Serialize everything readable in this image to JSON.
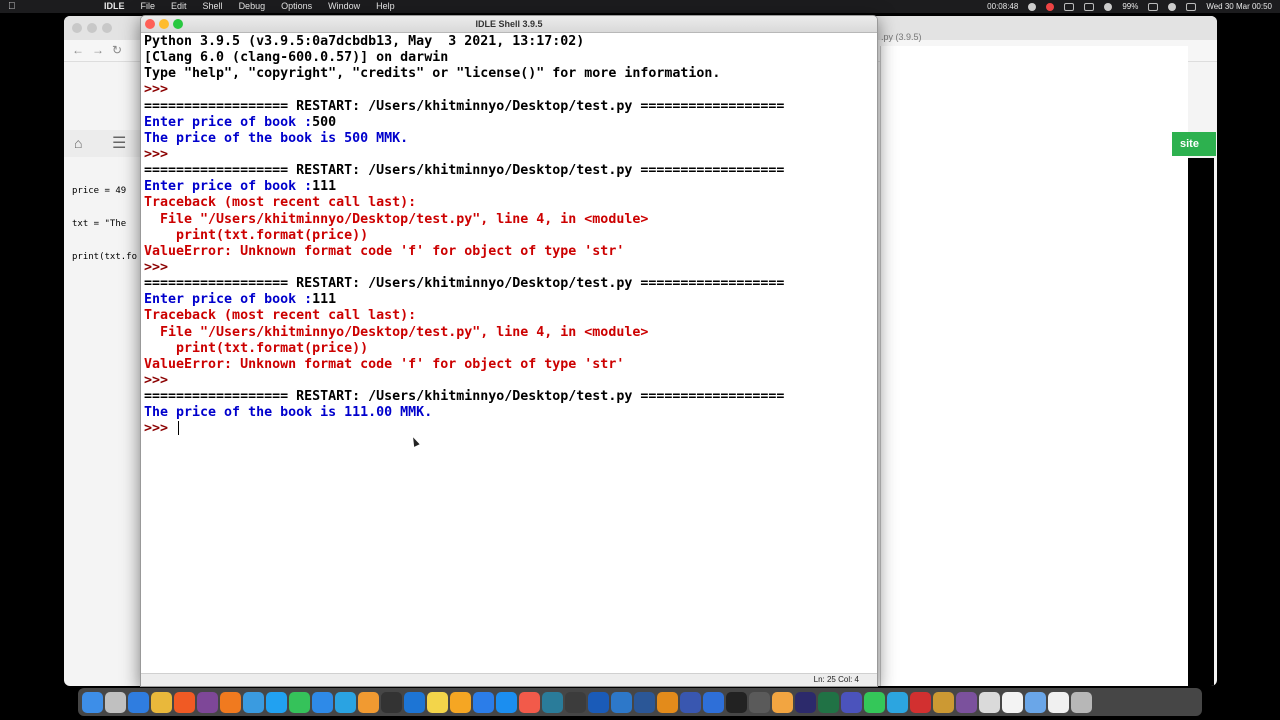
{
  "menubar": {
    "apple_icon": "apple-icon",
    "app_name": "IDLE",
    "menus": [
      "File",
      "Edit",
      "Shell",
      "Debug",
      "Options",
      "Window",
      "Help"
    ],
    "clock": "00:08:48",
    "battery": "99%",
    "datetime": "Wed 30 Mar  00:50"
  },
  "browser": {
    "right_title": ".py (3.9.5)",
    "green_button_label": "site",
    "code_lines": [
      "price = 49",
      "txt = \"The",
      "print(txt.fo"
    ]
  },
  "idle": {
    "title": "IDLE Shell 3.9.5",
    "status": "Ln: 25  Col: 4",
    "lines": [
      {
        "cls": "c-out",
        "text": "Python 3.9.5 (v3.9.5:0a7dcbdb13, May  3 2021, 13:17:02)"
      },
      {
        "cls": "c-out",
        "text": "[Clang 6.0 (clang-600.0.57)] on darwin"
      },
      {
        "cls": "c-out",
        "text": "Type \"help\", \"copyright\", \"credits\" or \"license()\" for more information."
      },
      {
        "cls": "c-prompt",
        "text": ">>>"
      },
      {
        "cls": "c-out",
        "text": "================== RESTART: /Users/khitminnyo/Desktop/test.py =================="
      },
      {
        "cls": "c-stdout",
        "text": "Enter price of book :",
        "input": "500"
      },
      {
        "cls": "c-stdout",
        "text": "The price of the book is 500 MMK."
      },
      {
        "cls": "c-prompt",
        "text": ">>>"
      },
      {
        "cls": "c-out",
        "text": "================== RESTART: /Users/khitminnyo/Desktop/test.py =================="
      },
      {
        "cls": "c-stdout",
        "text": "Enter price of book :",
        "input": "111"
      },
      {
        "cls": "c-err",
        "text": "Traceback (most recent call last):"
      },
      {
        "cls": "c-err",
        "text": "  File \"/Users/khitminnyo/Desktop/test.py\", line 4, in <module>"
      },
      {
        "cls": "c-err",
        "text": "    print(txt.format(price))"
      },
      {
        "cls": "c-err",
        "text": "ValueError: Unknown format code 'f' for object of type 'str'"
      },
      {
        "cls": "c-prompt",
        "text": ">>>"
      },
      {
        "cls": "c-out",
        "text": "================== RESTART: /Users/khitminnyo/Desktop/test.py =================="
      },
      {
        "cls": "c-stdout",
        "text": "Enter price of book :",
        "input": "111"
      },
      {
        "cls": "c-err",
        "text": "Traceback (most recent call last):"
      },
      {
        "cls": "c-err",
        "text": "  File \"/Users/khitminnyo/Desktop/test.py\", line 4, in <module>"
      },
      {
        "cls": "c-err",
        "text": "    print(txt.format(price))"
      },
      {
        "cls": "c-err",
        "text": "ValueError: Unknown format code 'f' for object of type 'str'"
      },
      {
        "cls": "c-prompt",
        "text": ">>>"
      },
      {
        "cls": "c-out",
        "text": "================== RESTART: /Users/khitminnyo/Desktop/test.py =================="
      },
      {
        "cls": "c-stdout",
        "text": "The price of the book is 111.00 MMK."
      },
      {
        "cls": "c-prompt",
        "text": ">>>",
        "cursor": true
      }
    ]
  },
  "dock": {
    "apps": [
      "finder-icon",
      "launchpad-icon",
      "safari-icon",
      "chrome-icon",
      "brave-icon",
      "tor-icon",
      "firefox-icon",
      "vscode-icon",
      "edge-icon",
      "whatsapp-icon",
      "mail-icon",
      "telegram-icon",
      "sublime-icon",
      "github-icon",
      "xcode-icon",
      "notes-icon",
      "pages-icon",
      "keynote-icon",
      "appstore-icon",
      "calendar-icon",
      "cisco-icon",
      "vpn-icon",
      "virtualbox-icon",
      "network-icon",
      "word-icon",
      "mysql-icon",
      "visio-icon",
      "v2ray-icon",
      "terminal-icon",
      "claquette-icon",
      "photos-icon",
      "photoshop-icon",
      "excel-icon",
      "teams-icon",
      "messages-icon",
      "tg-icon",
      "pdf-icon",
      "cyberduck-icon",
      "viber-icon",
      "preview-icon",
      "textedit-icon",
      "folder-icon",
      "docs-icon",
      "trash-icon"
    ],
    "colors": [
      "#3d8ee8",
      "#c0c0c0",
      "#2f7de0",
      "#e9b83b",
      "#f05a24",
      "#7e4798",
      "#f07a1f",
      "#3a9be0",
      "#21a1f1",
      "#35c25a",
      "#2e8ae8",
      "#2aa3e2",
      "#f19a31",
      "#333333",
      "#1d75d5",
      "#f3d54a",
      "#f5a623",
      "#2b7de9",
      "#1b8ef0",
      "#f25a4a",
      "#2a7c9a",
      "#3c3c3c",
      "#1a5bb8",
      "#2d78c9",
      "#2b5797",
      "#e38b1b",
      "#3957b0",
      "#2e6fd8",
      "#222222",
      "#5a5a5a",
      "#f2a541",
      "#2c2a6b",
      "#207245",
      "#4b53bc",
      "#34c759",
      "#2ca5e0",
      "#d23030",
      "#cc9933",
      "#7b519d",
      "#dadada",
      "#f3f3f3",
      "#6aa6e8",
      "#f0f0f0",
      "#b7b7b7"
    ]
  }
}
